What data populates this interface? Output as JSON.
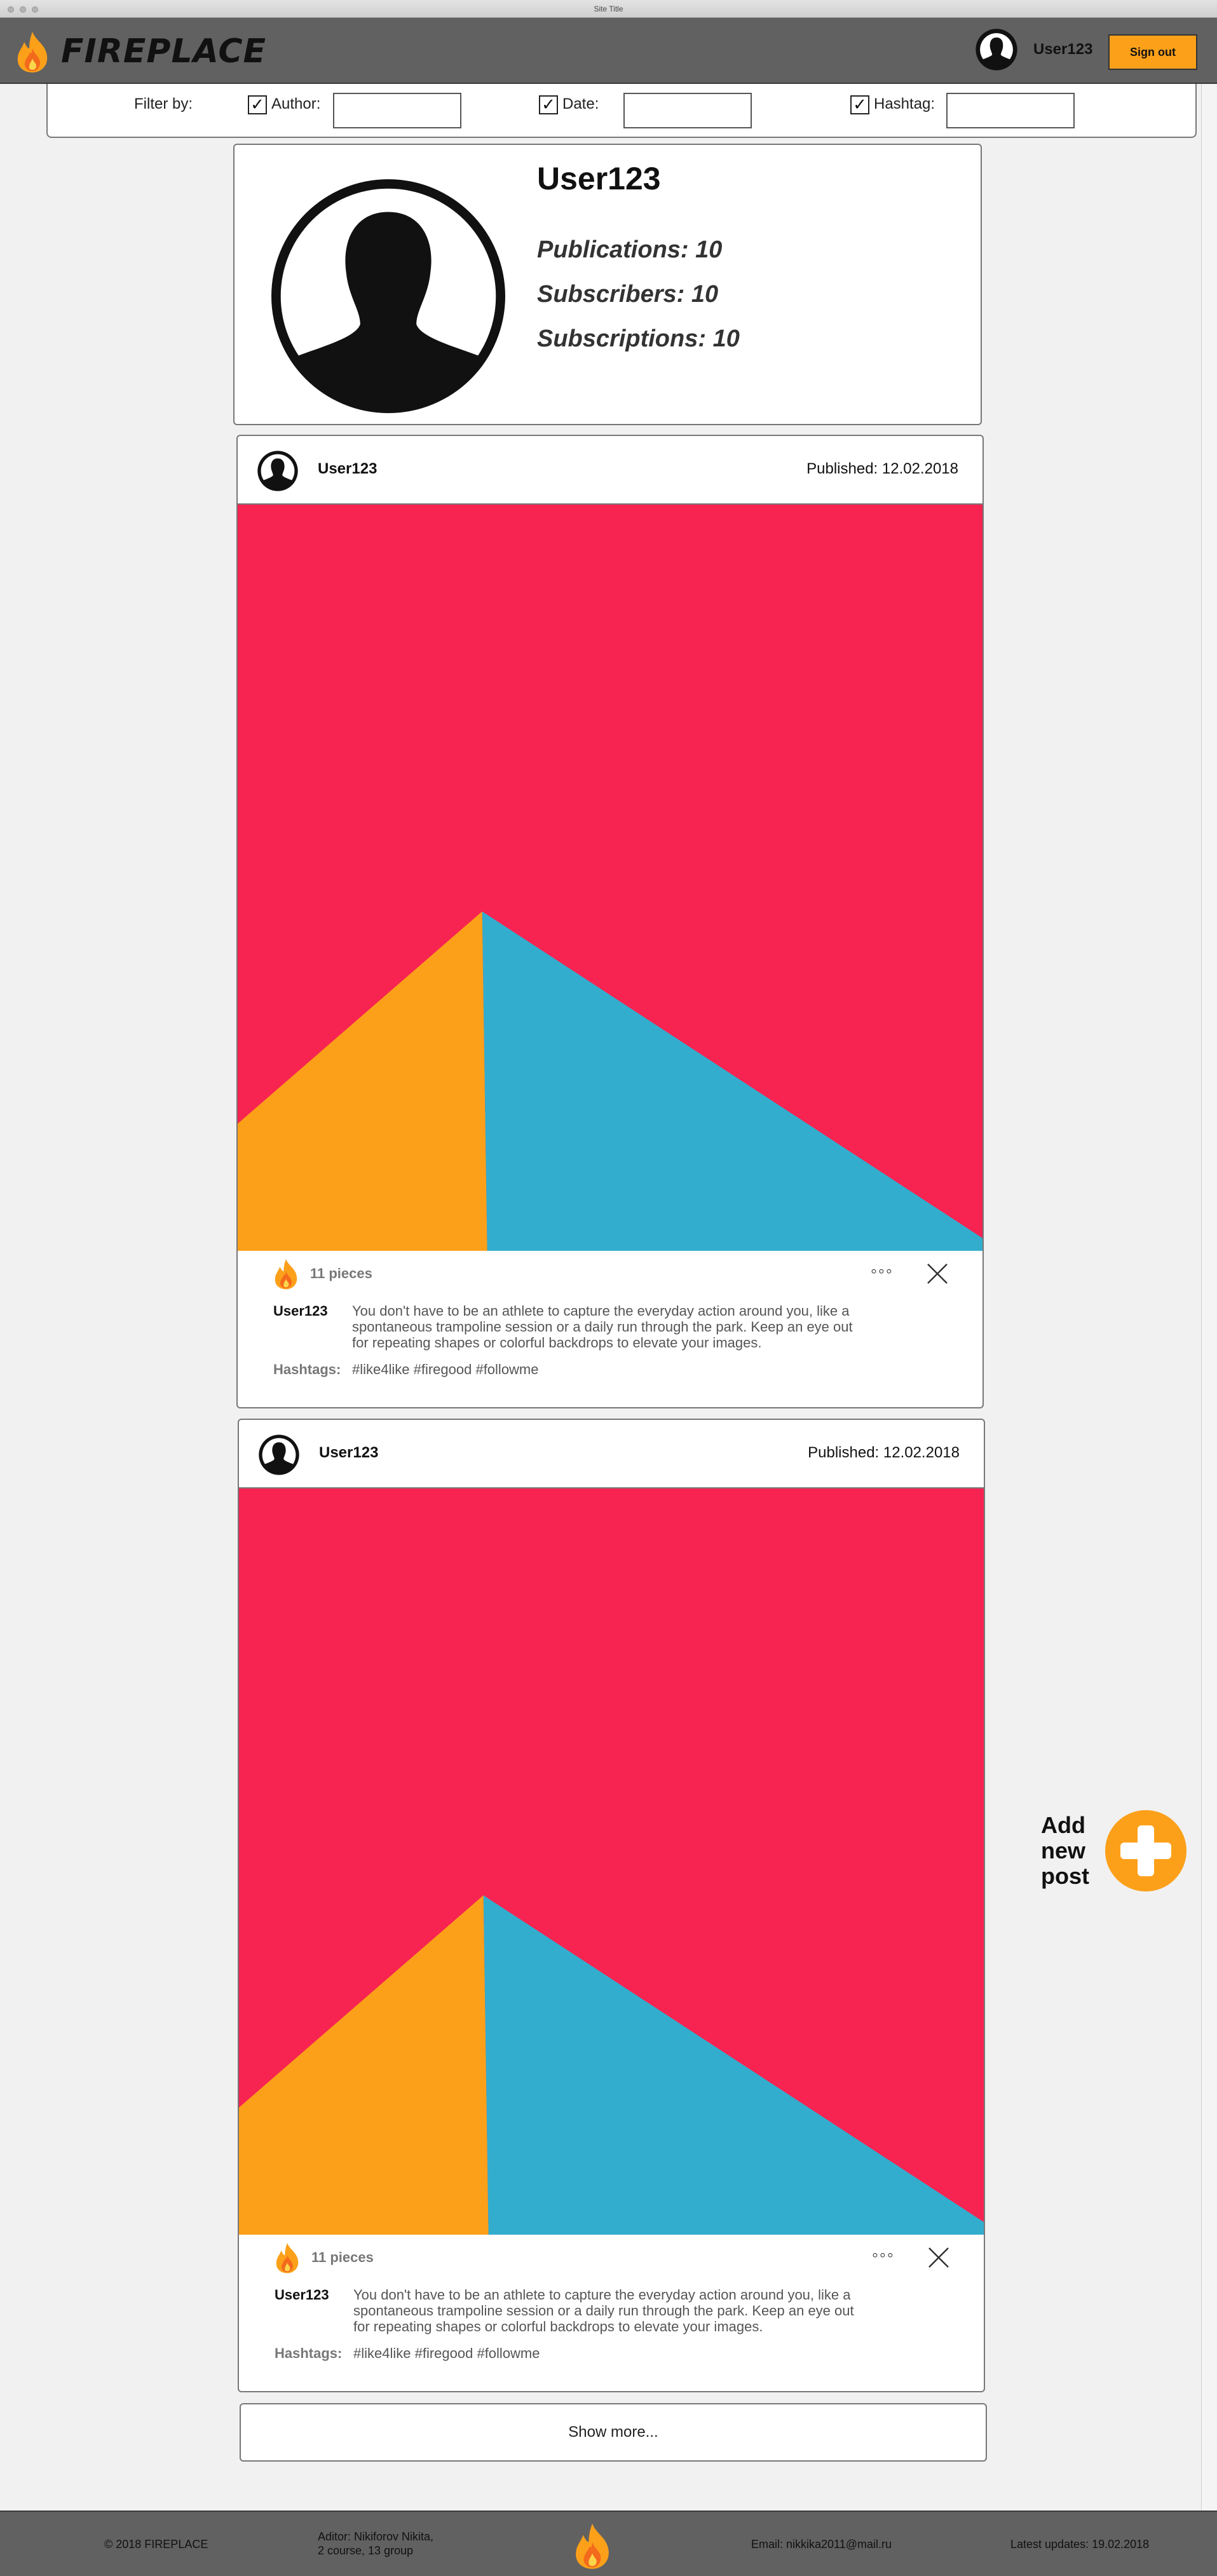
{
  "window": {
    "title": "Site Title"
  },
  "header": {
    "brand": "FIREPLACE",
    "user_name": "User123",
    "sign_out_label": "Sign out"
  },
  "filter": {
    "label": "Filter by:",
    "author": {
      "label": "Author:",
      "checked": true,
      "value": ""
    },
    "date": {
      "label": "Date:",
      "checked": true,
      "value": ""
    },
    "hashtag": {
      "label": "Hashtag:",
      "checked": true,
      "value": ""
    }
  },
  "profile": {
    "user_name": "User123",
    "publications": "Publications: 10",
    "subscribers": "Subscribers: 10",
    "subscriptions": "Subscriptions: 10"
  },
  "posts": [
    {
      "author": "User123",
      "published": "Published: 12.02.2018",
      "likes": "11 pieces",
      "more_icon": "ellipsis-icon",
      "caption_user": "User123",
      "caption_lines": [
        "You don't have to be an athlete to capture the everyday action around you, like a",
        "spontaneous trampoline session or a daily run through the park. Keep an eye out",
        "for repeating shapes or colorful backdrops to elevate your images."
      ],
      "hashtags_label": "Hashtags:",
      "hashtags": "#like4like #firegood #followme",
      "image_colors": {
        "background": "#f72351",
        "left": "#fca01a",
        "right": "#33adcd"
      }
    },
    {
      "author": "User123",
      "published": "Published: 12.02.2018",
      "likes": "11 pieces",
      "more_icon": "ellipsis-icon",
      "caption_user": "User123",
      "caption_lines": [
        "You don't have to be an athlete to capture the everyday action around you, like a",
        "spontaneous trampoline session or a daily run through the park. Keep an eye out",
        "for repeating shapes or colorful backdrops to elevate your images."
      ],
      "hashtags_label": "Hashtags:",
      "hashtags": "#like4like #firegood #followme",
      "image_colors": {
        "background": "#f72351",
        "left": "#fca01a",
        "right": "#33adcd"
      }
    }
  ],
  "show_more_label": "Show more...",
  "add_post": {
    "lines": [
      "Add",
      "new",
      "post"
    ],
    "icon": "plus-icon",
    "color": "#fca01a"
  },
  "footer": {
    "copyright": "© 2018 FIREPLACE",
    "editor_line1": "Aditor: Nikiforov Nikita,",
    "editor_line2": "2 course, 13 group",
    "email": "Email: nikkika2011@mail.ru",
    "latest_updates": "Latest updates: 19.02.2018"
  },
  "colors": {
    "header": "#616161",
    "accent": "#fca01a"
  }
}
